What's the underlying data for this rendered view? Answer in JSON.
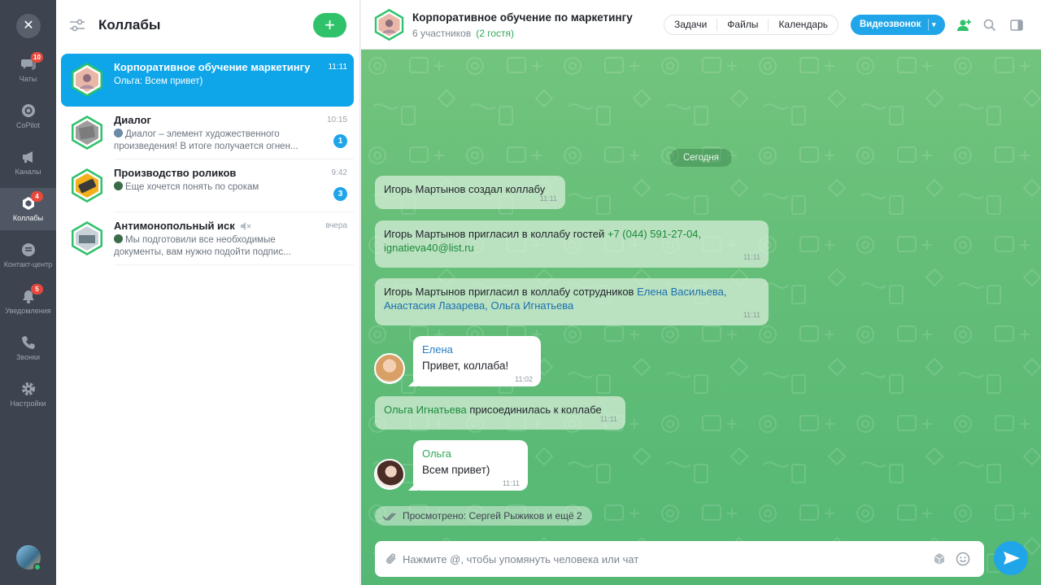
{
  "rail": {
    "items": [
      {
        "label": "Чаты",
        "badge": "10"
      },
      {
        "label": "CoPilot",
        "badge": ""
      },
      {
        "label": "Каналы",
        "badge": ""
      },
      {
        "label": "Коллабы",
        "badge": "4"
      },
      {
        "label": "Контакт-центр",
        "badge": ""
      },
      {
        "label": "Уведомления",
        "badge": "5"
      },
      {
        "label": "Звонки",
        "badge": ""
      },
      {
        "label": "Настройки",
        "badge": ""
      }
    ]
  },
  "panel": {
    "title": "Коллабы",
    "chats": [
      {
        "name": "Корпоративное обучение маркетингу",
        "time": "11:11",
        "preview": "Ольга: Всем привет)",
        "badge": ""
      },
      {
        "name": "Диалог",
        "time": "10:15",
        "preview": "Диалог – элемент художественного произведения! В итоге получается огнен...",
        "badge": "1"
      },
      {
        "name": "Производство роликов",
        "time": "9:42",
        "preview": "Еще хочется понять по срокам",
        "badge": "3"
      },
      {
        "name": "Антимонопольный иск",
        "time": "вчера",
        "preview": "Мы подготовили все необходимые документы, вам нужно подойти подпис...",
        "badge": ""
      }
    ]
  },
  "header": {
    "title": "Корпоративное обучение по маркетингу",
    "participants": "6 участников",
    "guests": "(2 гостя)",
    "tabs": [
      "Задачи",
      "Файлы",
      "Календарь"
    ],
    "video_label": "Видеозвонок"
  },
  "chat": {
    "date": "Сегодня",
    "sys1": {
      "who": "Игорь Мартынов",
      "text": " создал коллабу",
      "time": "11:11"
    },
    "sys2": {
      "who": "Игорь Мартынов",
      "text": " пригласил в коллабу гостей ",
      "link": "+7 (044) 591-27-04, ignatieva40@list.ru",
      "time": "11:11"
    },
    "sys3": {
      "who": "Игорь Мартынов",
      "text": " пригласил в коллабу сотрудников ",
      "link": "Елена Васильева, Анастасия Лазарева, Ольга Игнатьева",
      "time": "11:11"
    },
    "msg1": {
      "author": "Елена",
      "text": "Привет, коллаба!",
      "time": "11:02"
    },
    "sys4": {
      "who": "Ольга Игнатьева",
      "text": " присоединилась к коллабе",
      "time": "11:11"
    },
    "msg2": {
      "author": "Ольга",
      "text": "Всем привет)",
      "time": "11:11"
    },
    "seen": "Просмотрено: Сергей Рыжиков и ещё 2"
  },
  "composer": {
    "placeholder": "Нажмите @, чтобы упомянуть человека или чат"
  },
  "colors": {
    "accent_blue": "#1fa5e8",
    "accent_green": "#2fc26b",
    "rail_bg": "#3d4450",
    "badge_red": "#e8493d"
  }
}
